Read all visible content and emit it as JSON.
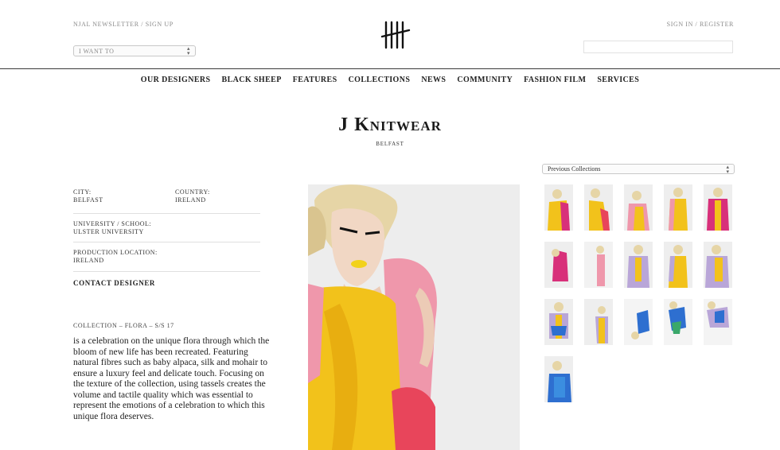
{
  "header": {
    "newsletter_link": "NJAL NEWSLETTER / SIGN UP",
    "signin_link": "SIGN IN / REGISTER",
    "i_want_to": "I WANT TO",
    "logo_icon": "tally-hash-logo-icon"
  },
  "nav": {
    "items": [
      {
        "label": "Our Designers"
      },
      {
        "label": "Black Sheep"
      },
      {
        "label": "Features"
      },
      {
        "label": "Collections"
      },
      {
        "label": "News"
      },
      {
        "label": "Community"
      },
      {
        "label": "Fashion Film"
      },
      {
        "label": "Services"
      }
    ]
  },
  "designer": {
    "name": "J Knitwear",
    "city_subtitle": "BELFAST"
  },
  "info": {
    "city_label": "CITY:",
    "city_value": "BELFAST",
    "country_label": "COUNTRY:",
    "country_value": "IRELAND",
    "university_label": "UNIVERSITY / SCHOOL:",
    "university_value": "ULSTER UNIVERSITY",
    "production_label": "PRODUCTION LOCATION:",
    "production_value": "IRELAND",
    "contact": "CONTACT DESIGNER"
  },
  "collection": {
    "title": "COLLECTION – FLORA – S/S 17",
    "description": "is a celebration on the unique flora through which the bloom of new life has been recreated. Featuring natural fibres such as baby alpaca, silk and mohair to ensure a luxury feel and delicate touch. Focusing on the texture of the collection, using tassels creates the volume and tactile quality which was essential to represent the emotions of a celebration to which this unique flora deserves."
  },
  "gallery": {
    "previous_collections": "Previous Collections",
    "thumb_count": 16
  },
  "colors": {
    "yellow": "#f2c21b",
    "pink": "#ee8fa6",
    "magenta": "#d8307a",
    "blue": "#2e6fd0",
    "lilac": "#b9a6d8"
  }
}
